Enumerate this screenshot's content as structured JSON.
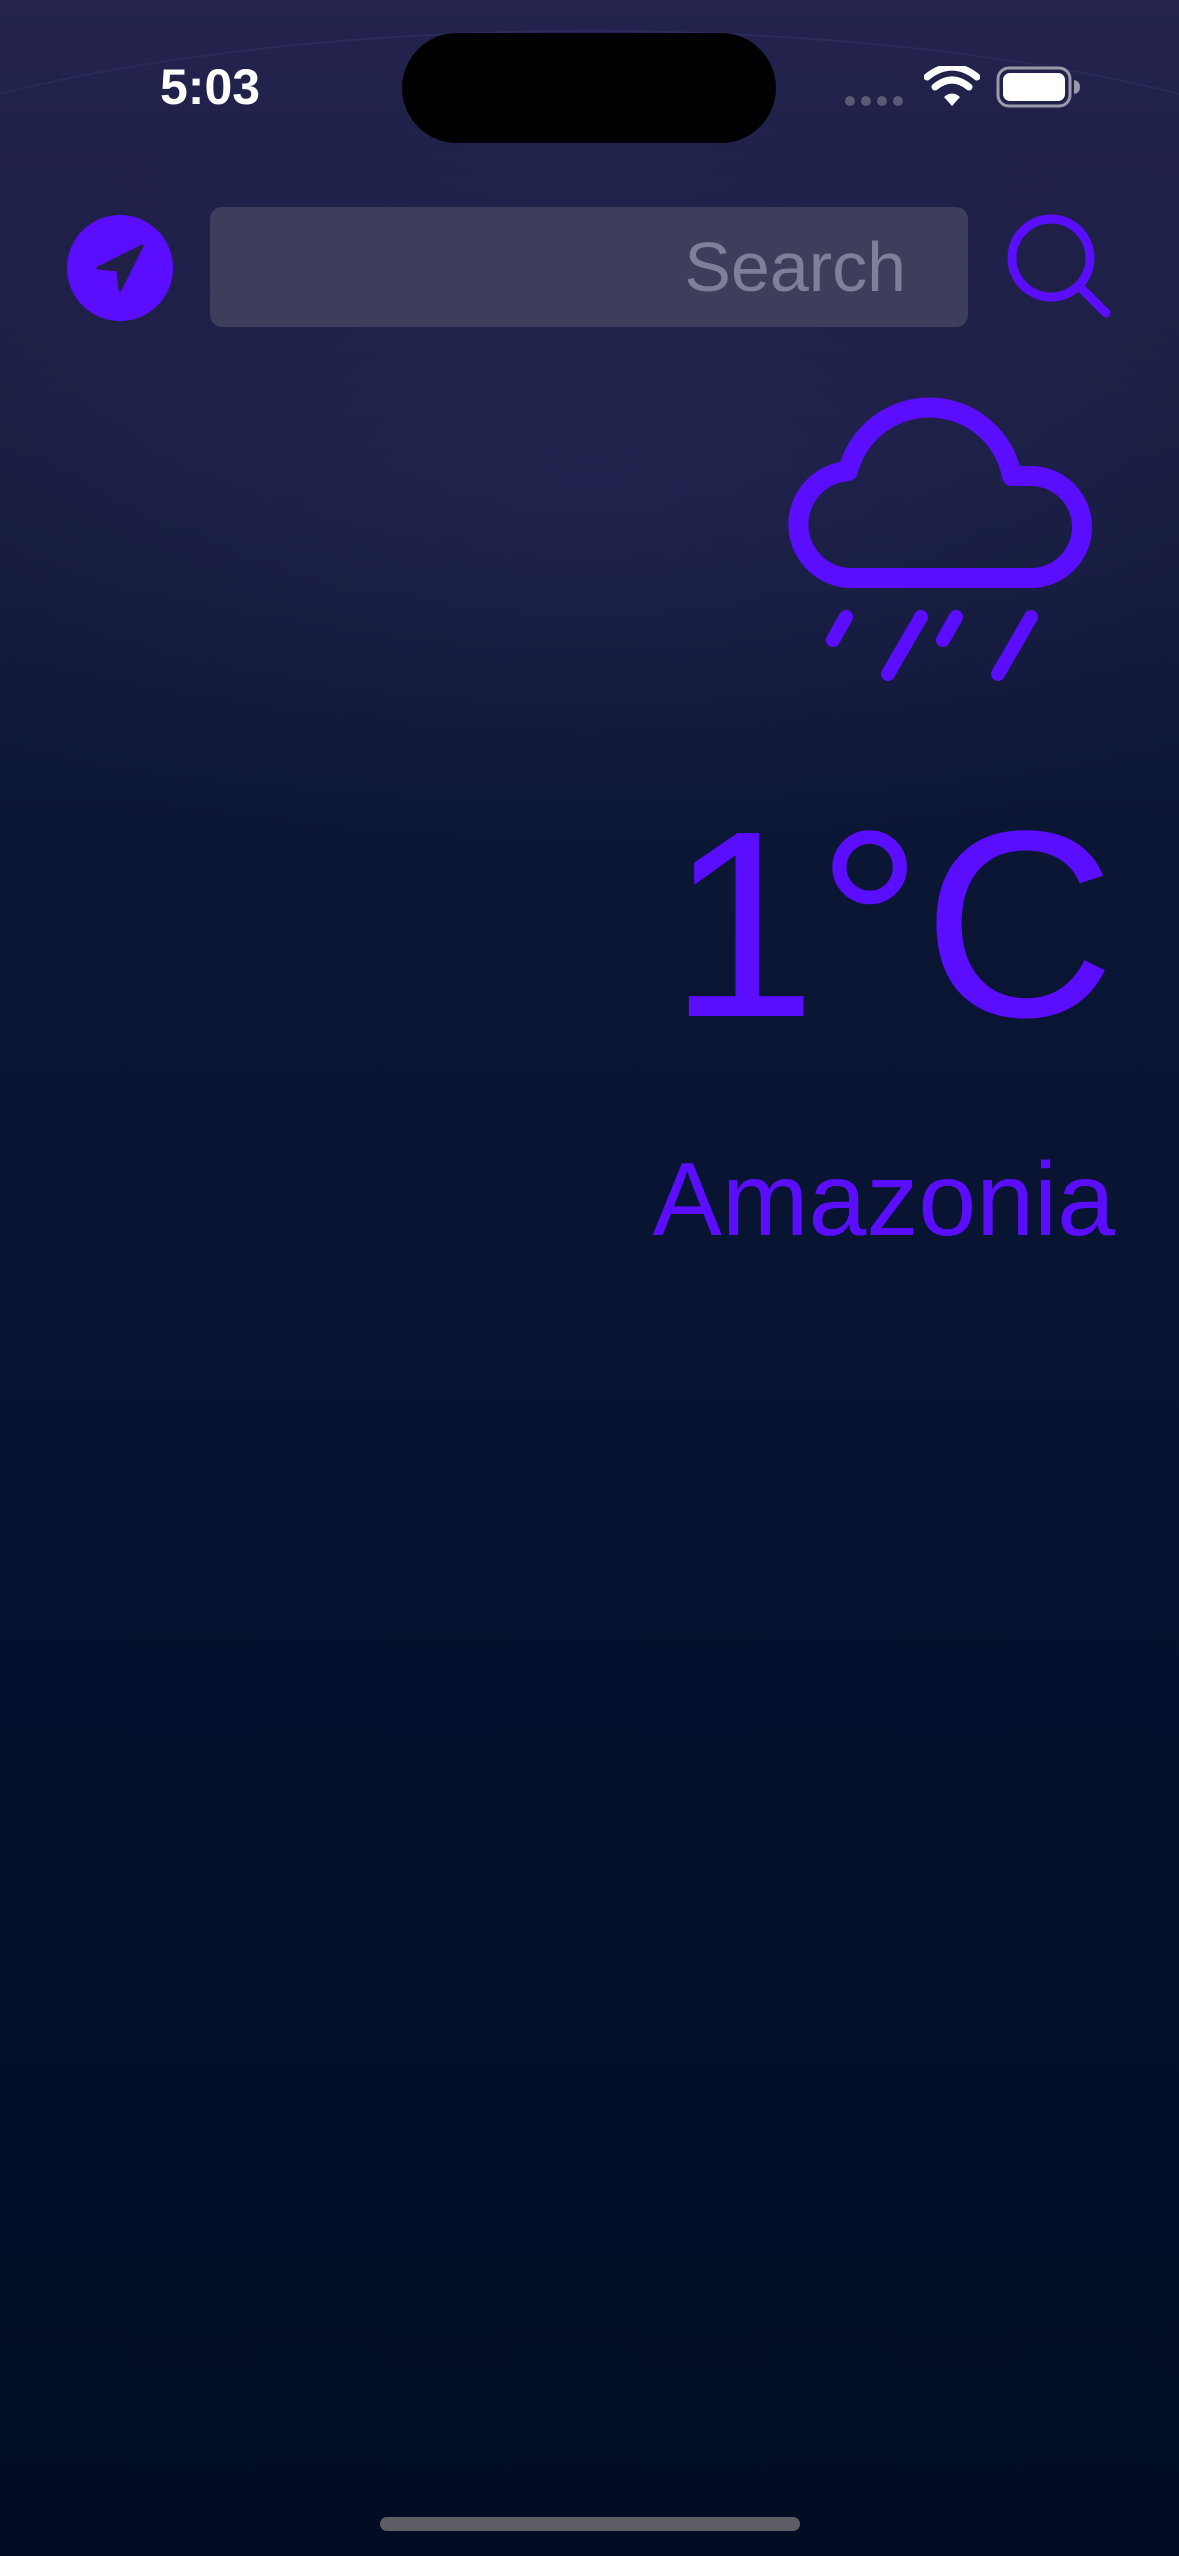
{
  "status_bar": {
    "time": "5:03",
    "icons": [
      "cellular-signal-icon",
      "wifi-icon",
      "battery-icon"
    ]
  },
  "search": {
    "placeholder": "Search",
    "value": ""
  },
  "controls": {
    "location_icon": "location-arrow-icon",
    "search_icon": "magnifying-glass-icon"
  },
  "weather": {
    "condition_icon": "cloud-rain-icon",
    "temperature": "1°C",
    "city": "Amazonia"
  },
  "colors": {
    "accent": "#5a0dff",
    "background_top": "#23234e",
    "background_bottom": "#020d24",
    "search_field": "#3d3e5b",
    "placeholder": "#7e7f98"
  }
}
